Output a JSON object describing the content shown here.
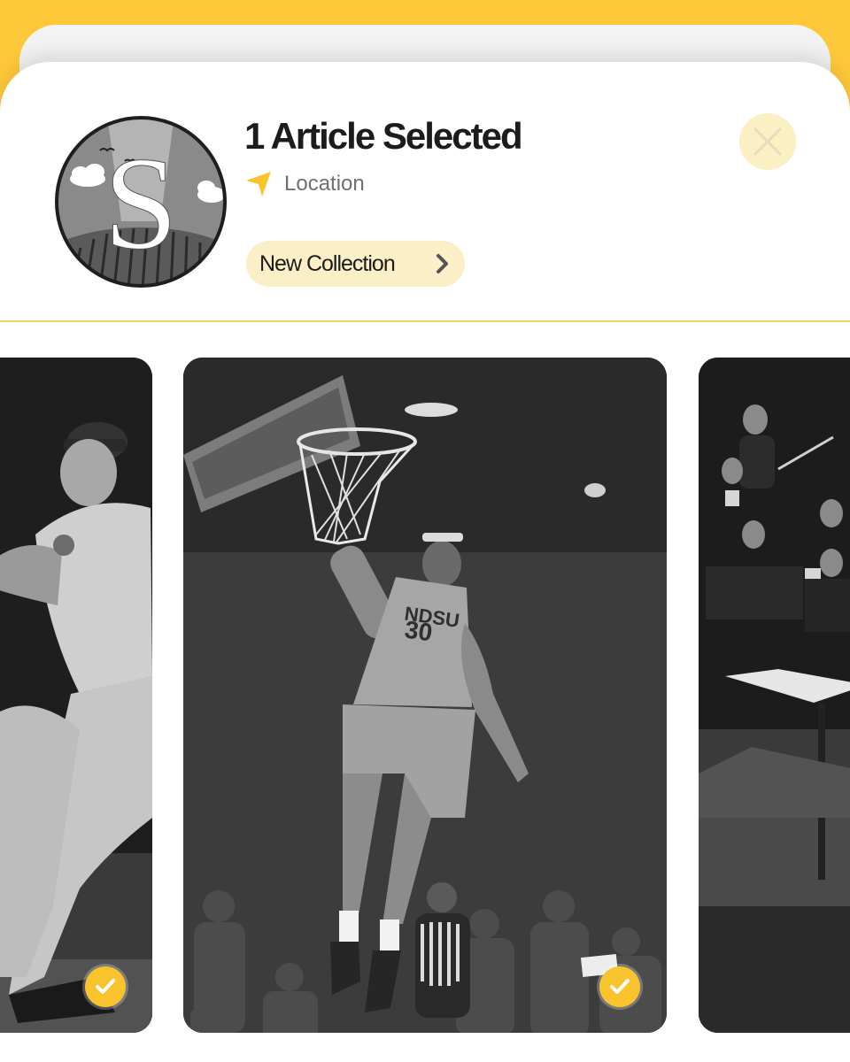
{
  "header": {
    "title": "1 Article Selected",
    "location_label": "Location",
    "collection_button_label": "New Collection"
  },
  "icons": {
    "location": "navigation-arrow-icon",
    "collection_chevron": "chevron-right-icon",
    "close": "close-icon",
    "check": "checkmark-icon"
  },
  "cards": [
    {
      "subject": "baseball pitcher",
      "selected": true
    },
    {
      "subject": "basketball player dunking",
      "jersey_text": "NDSU",
      "jersey_number": "30",
      "selected": true
    },
    {
      "subject": "orchestra musicians",
      "selected": false
    }
  ],
  "colors": {
    "accent": "#FCC83A",
    "button_bg": "#FBEFC8",
    "check_bg": "#F9C32D",
    "close_bg": "#FBEFC4"
  }
}
